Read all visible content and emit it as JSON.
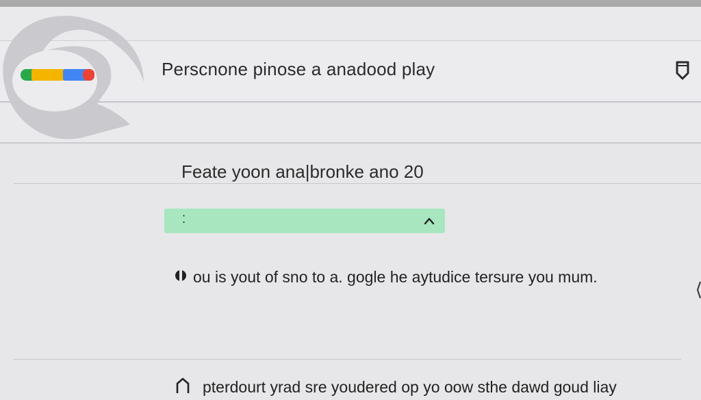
{
  "header": {
    "title": "Ρersсnone pinose a   anadood play"
  },
  "section": {
    "title": "Feate yoon ana|bronke ano  20"
  },
  "dropdown": {
    "value": "⁚"
  },
  "message": {
    "text": "ou is yout of sno to a. gogle he aytudice tersure you mum."
  },
  "footer": {
    "text": "pterdourt yrad sre youdered op yo oow sthe dawd goud liay"
  },
  "colors": {
    "background": "#e7e7e9",
    "dropdown_fill": "#a8e6bf",
    "logo_green": "#2aa84a",
    "logo_yellow": "#f4b400",
    "logo_blue": "#4285f4",
    "logo_red": "#ea4335"
  },
  "icons": {
    "header_action": "shield-icon",
    "dropdown_chevron": "chevron-up-icon",
    "message_icon": "info-bullet-icon",
    "footer_icon": "home-icon",
    "app_logo": "google-play-logo"
  }
}
